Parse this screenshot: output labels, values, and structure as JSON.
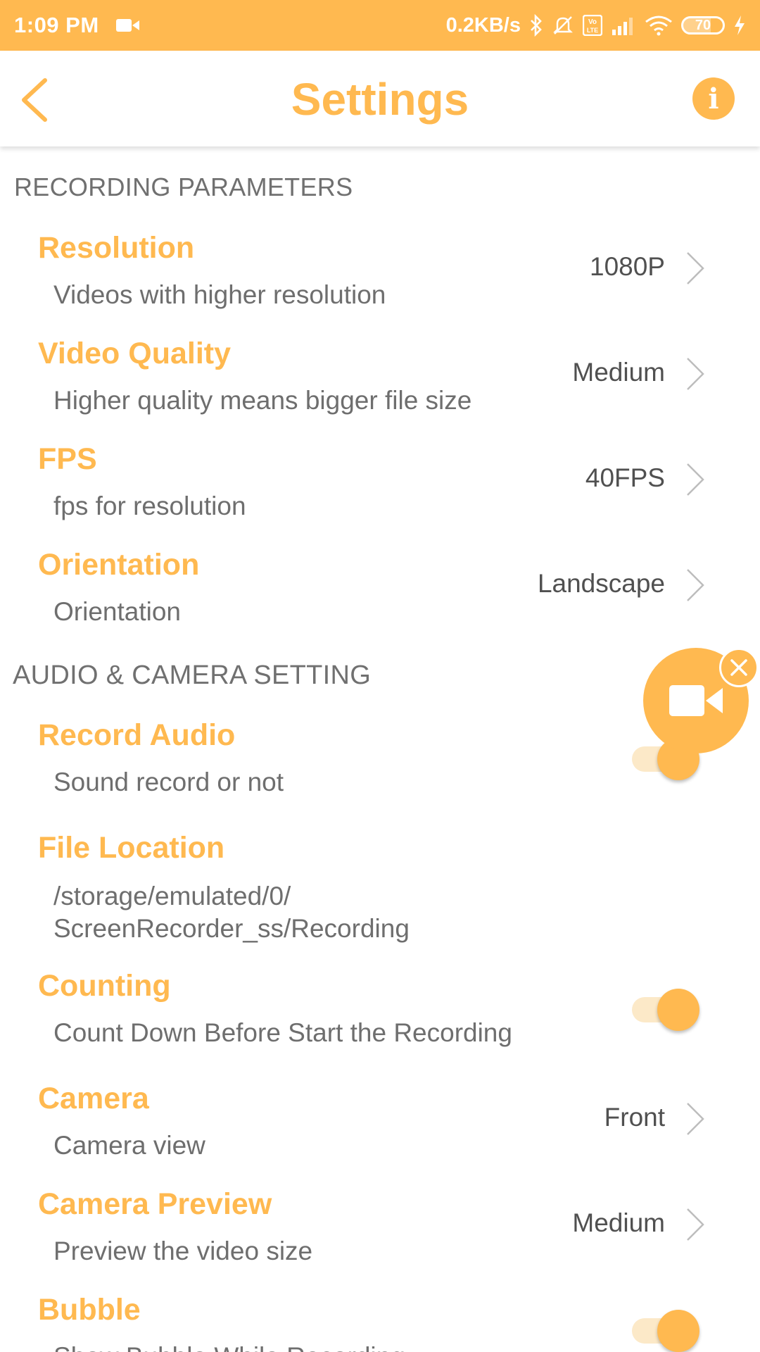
{
  "status_bar": {
    "time": "1:09 PM",
    "net_speed": "0.2KB/s",
    "battery": "70",
    "icons": [
      "video-camera-icon",
      "bluetooth-icon",
      "mute-bell-icon",
      "volte-icon",
      "signal-icon",
      "wifi-icon",
      "battery-icon",
      "charging-icon"
    ]
  },
  "header": {
    "title": "Settings",
    "info_glyph": "i"
  },
  "sections": {
    "recording": "RECORDING PARAMETERS",
    "audio_camera": "AUDIO & CAMERA SETTING"
  },
  "settings": {
    "resolution": {
      "title": "Resolution",
      "subtitle": "Videos with higher resolution",
      "value": "1080P"
    },
    "video_quality": {
      "title": "Video Quality",
      "subtitle": "Higher quality means bigger file size",
      "value": "Medium"
    },
    "fps": {
      "title": "FPS",
      "subtitle": "fps for resolution",
      "value": "40FPS"
    },
    "orientation": {
      "title": "Orientation",
      "subtitle": "Orientation",
      "value": "Landscape"
    },
    "record_audio": {
      "title": "Record Audio",
      "subtitle": "Sound record or not",
      "enabled": true
    },
    "file_location": {
      "title": "File Location",
      "subtitle": "/storage/emulated/0/\nScreenRecorder_ss/Recording"
    },
    "counting": {
      "title": "Counting",
      "subtitle": "Count Down Before Start the Recording",
      "enabled": true
    },
    "camera": {
      "title": "Camera",
      "subtitle": "Camera view",
      "value": "Front"
    },
    "camera_preview": {
      "title": "Camera Preview",
      "subtitle": "Preview the video size",
      "value": "Medium"
    },
    "bubble": {
      "title": "Bubble",
      "subtitle": "Show Bubble While Recording",
      "enabled": true
    }
  },
  "colors": {
    "accent": "#FFB950",
    "toggle_track": "#FCE9C8",
    "subtitle": "#6e6e6e",
    "section": "#707070"
  }
}
